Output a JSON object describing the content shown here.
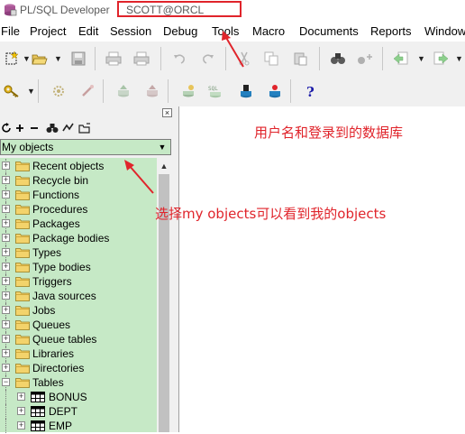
{
  "window": {
    "app_title": "PL/SQL Developer",
    "connection": "SCOTT@ORCL"
  },
  "menu": [
    "File",
    "Project",
    "Edit",
    "Session",
    "Debug",
    "Tools",
    "Macro",
    "Documents",
    "Reports",
    "Window"
  ],
  "browser": {
    "filter_value": "My objects",
    "close_glyph": "×",
    "items": [
      {
        "label": "Recent objects",
        "expander": "+"
      },
      {
        "label": "Recycle bin",
        "expander": "+"
      },
      {
        "label": "Functions",
        "expander": "+"
      },
      {
        "label": "Procedures",
        "expander": "+"
      },
      {
        "label": "Packages",
        "expander": "+"
      },
      {
        "label": "Package bodies",
        "expander": "+"
      },
      {
        "label": "Types",
        "expander": "+"
      },
      {
        "label": "Type bodies",
        "expander": "+"
      },
      {
        "label": "Triggers",
        "expander": "+"
      },
      {
        "label": "Java sources",
        "expander": "+"
      },
      {
        "label": "Jobs",
        "expander": "+"
      },
      {
        "label": "Queues",
        "expander": "+"
      },
      {
        "label": "Queue tables",
        "expander": "+"
      },
      {
        "label": "Libraries",
        "expander": "+"
      },
      {
        "label": "Directories",
        "expander": "+"
      },
      {
        "label": "Tables",
        "expander": "−"
      }
    ],
    "tables": [
      {
        "label": "BONUS",
        "expander": "+"
      },
      {
        "label": "DEPT",
        "expander": "+"
      },
      {
        "label": "EMP",
        "expander": "+"
      }
    ]
  },
  "annotations": {
    "user_db": "用户名和登录到的数据库",
    "my_objects": "选择my objects可以看到我的objects"
  },
  "colors": {
    "tree_bg": "#c6e9c6",
    "annotation": "#e0242b"
  }
}
